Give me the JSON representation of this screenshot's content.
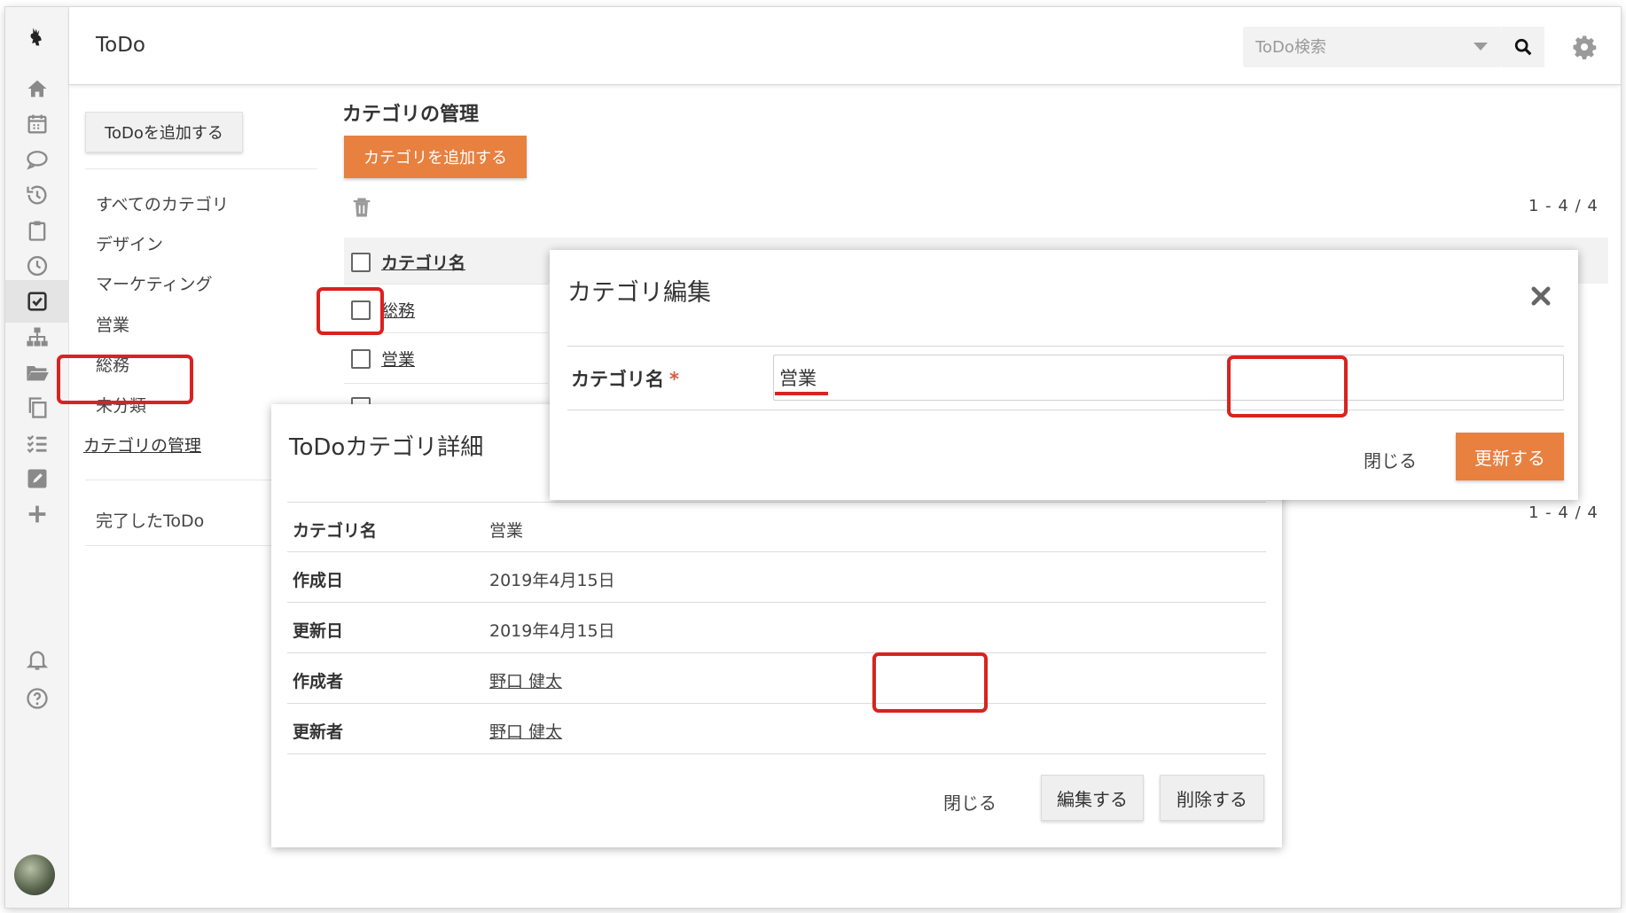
{
  "header": {
    "title": "ToDo",
    "search_placeholder": "ToDo検索"
  },
  "sidebar": {
    "add_todo_label": "ToDoを追加する",
    "categories": [
      "すべてのカテゴリ",
      "デザイン",
      "マーケティング",
      "営業",
      "総務",
      "未分類"
    ],
    "manage_label": "カテゴリの管理",
    "done_label": "完了したToDo"
  },
  "main": {
    "title": "カテゴリの管理",
    "add_category_label": "カテゴリを追加する",
    "pager_top": "1 - 4 / 4",
    "pager_bottom": "1 - 4 / 4",
    "column_header": "カテゴリ名",
    "rows": [
      "総務",
      "営業"
    ]
  },
  "detail_dialog": {
    "title": "ToDoカテゴリ詳細",
    "fields": [
      {
        "label": "カテゴリ名",
        "value": "営業"
      },
      {
        "label": "作成日",
        "value": "2019年4月15日"
      },
      {
        "label": "更新日",
        "value": "2019年4月15日"
      },
      {
        "label": "作成者",
        "value": "野口 健太"
      },
      {
        "label": "更新者",
        "value": "野口 健太"
      }
    ],
    "close_label": "閉じる",
    "edit_label": "編集する",
    "delete_label": "削除する"
  },
  "edit_dialog": {
    "title": "カテゴリ編集",
    "field_label": "カテゴリ名",
    "required_mark": "*",
    "field_value": "営業",
    "close_label": "閉じる",
    "update_label": "更新する"
  },
  "colors": {
    "accent": "#e8803f",
    "highlight": "#d8231f"
  },
  "icons": [
    "logo-icon",
    "home-icon",
    "calendar-icon",
    "chat-icon",
    "history-icon",
    "clipboard-icon",
    "clock-icon",
    "todo-check-icon",
    "org-chart-icon",
    "folder-icon",
    "copy-icon",
    "checklist-icon",
    "edit-icon",
    "plus-icon",
    "bell-icon",
    "help-icon",
    "search-icon",
    "gear-icon",
    "trash-icon",
    "close-icon"
  ]
}
